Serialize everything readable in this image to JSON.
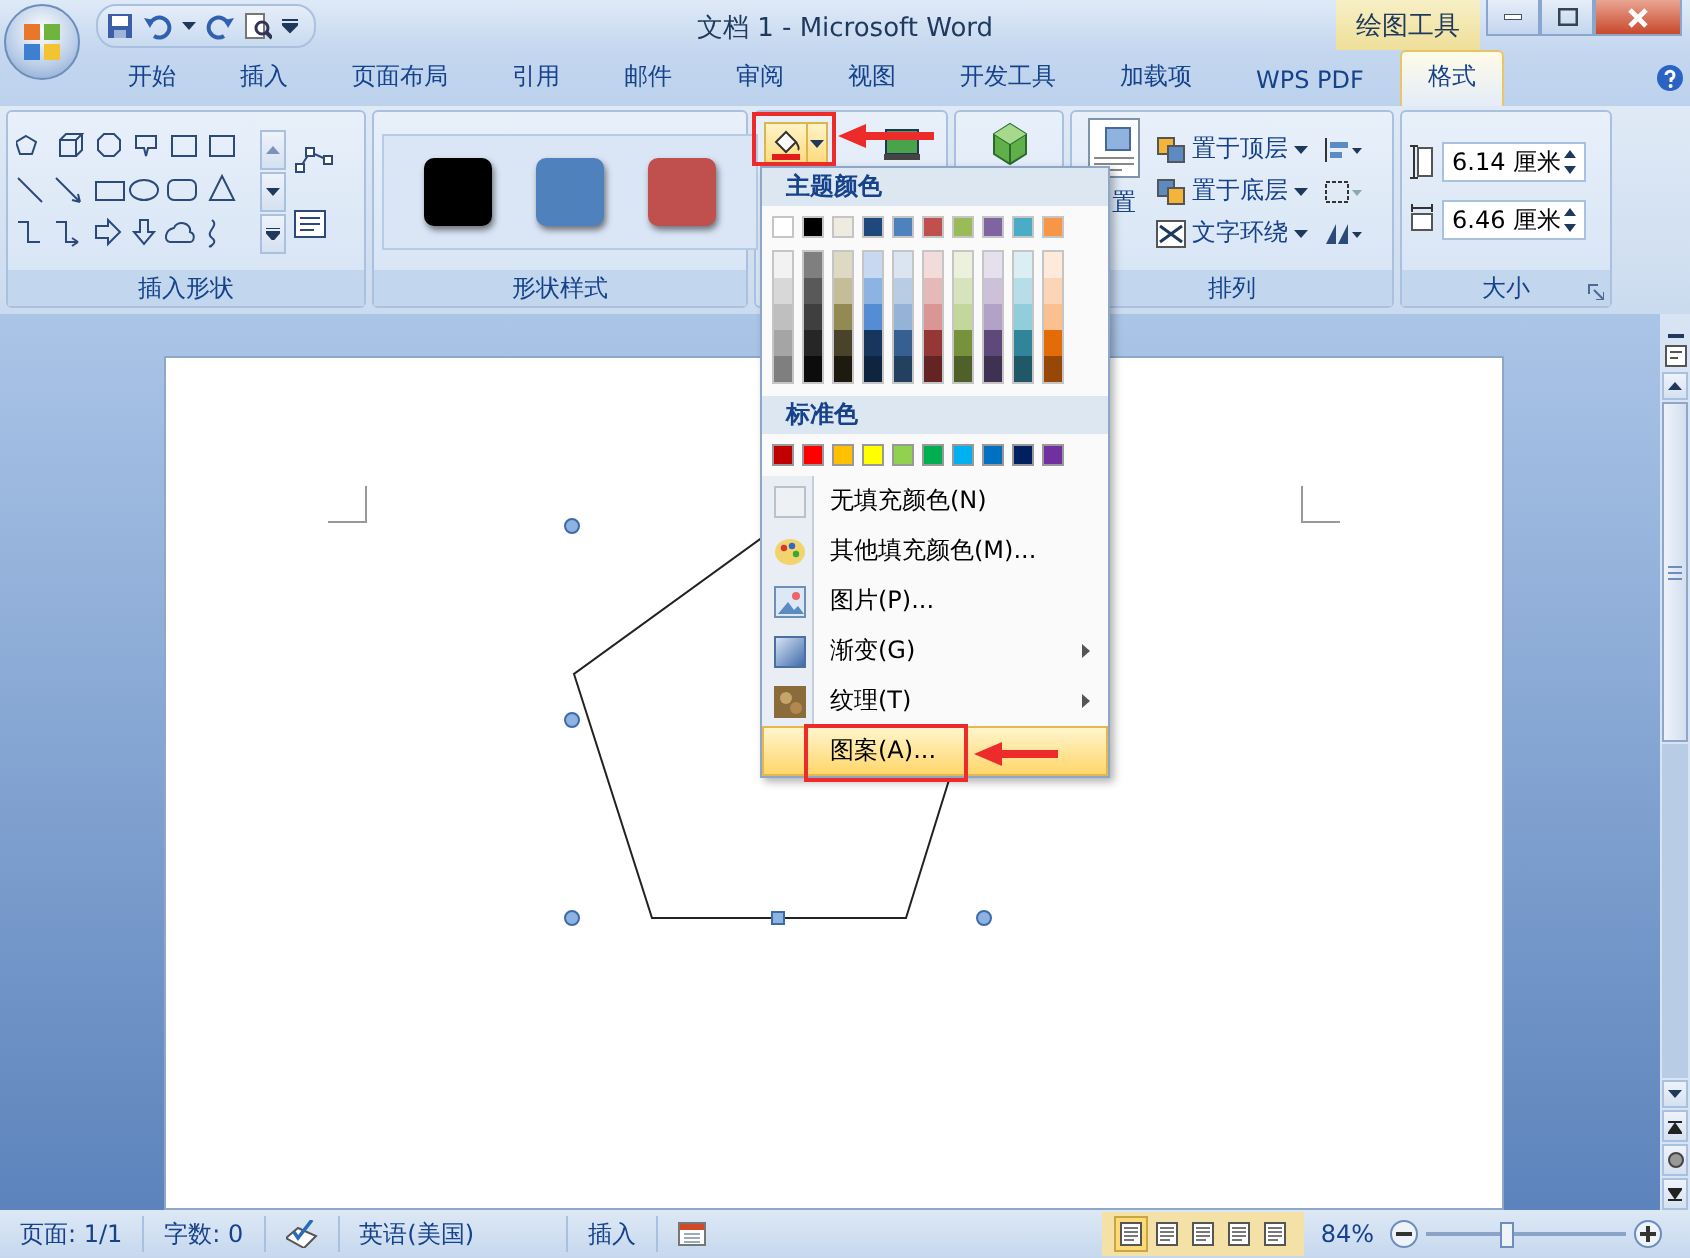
{
  "title_bar": {
    "title": "文档 1 - Microsoft Word",
    "context_label": "绘图工具"
  },
  "tabs": [
    {
      "label": "开始",
      "selected": false
    },
    {
      "label": "插入",
      "selected": false
    },
    {
      "label": "页面布局",
      "selected": false
    },
    {
      "label": "引用",
      "selected": false
    },
    {
      "label": "邮件",
      "selected": false
    },
    {
      "label": "审阅",
      "selected": false
    },
    {
      "label": "视图",
      "selected": false
    },
    {
      "label": "开发工具",
      "selected": false
    },
    {
      "label": "加载项",
      "selected": false
    },
    {
      "label": "WPS PDF",
      "selected": false
    },
    {
      "label": "格式",
      "selected": true
    }
  ],
  "shape_group": {
    "label": "插入形状"
  },
  "style_group": {
    "label": "形状样式",
    "swatches": [
      {
        "color": "#000000"
      },
      {
        "color": "#4f81bd"
      },
      {
        "color": "#c0504d"
      }
    ]
  },
  "arrange_group": {
    "label": "排列",
    "position_label": "置",
    "items": [
      {
        "label": "置于顶层"
      },
      {
        "label": "置于底层"
      },
      {
        "label": "文字环绕"
      }
    ]
  },
  "size_group": {
    "label": "大小",
    "height": "6.14 厘米",
    "width": "6.46 厘米"
  },
  "fill_menu": {
    "theme_heading": "主题颜色",
    "theme_colors": [
      {
        "color": "#ffffff",
        "shades": [
          {
            "color": "#f2f2f2"
          },
          {
            "color": "#d8d8d8"
          },
          {
            "color": "#bfbfbf"
          },
          {
            "color": "#a5a5a5"
          },
          {
            "color": "#7f7f7f"
          }
        ]
      },
      {
        "color": "#000000",
        "shades": [
          {
            "color": "#7f7f7f"
          },
          {
            "color": "#595959"
          },
          {
            "color": "#3f3f3f"
          },
          {
            "color": "#262626"
          },
          {
            "color": "#0c0c0c"
          }
        ]
      },
      {
        "color": "#eeece1",
        "shades": [
          {
            "color": "#ddd9c3"
          },
          {
            "color": "#c4bd97"
          },
          {
            "color": "#938953"
          },
          {
            "color": "#494429"
          },
          {
            "color": "#1d1b10"
          }
        ]
      },
      {
        "color": "#1f497d",
        "shades": [
          {
            "color": "#c6d9f0"
          },
          {
            "color": "#8db3e2"
          },
          {
            "color": "#548dd4"
          },
          {
            "color": "#17365d"
          },
          {
            "color": "#0f243e"
          }
        ]
      },
      {
        "color": "#4f81bd",
        "shades": [
          {
            "color": "#dbe5f1"
          },
          {
            "color": "#b8cce4"
          },
          {
            "color": "#95b3d7"
          },
          {
            "color": "#366092"
          },
          {
            "color": "#244061"
          }
        ]
      },
      {
        "color": "#c0504d",
        "shades": [
          {
            "color": "#f2dcdb"
          },
          {
            "color": "#e5b9b7"
          },
          {
            "color": "#d99694"
          },
          {
            "color": "#953734"
          },
          {
            "color": "#632423"
          }
        ]
      },
      {
        "color": "#9bbb59",
        "shades": [
          {
            "color": "#ebf1dd"
          },
          {
            "color": "#d7e3bc"
          },
          {
            "color": "#c3d69b"
          },
          {
            "color": "#76923c"
          },
          {
            "color": "#4f6128"
          }
        ]
      },
      {
        "color": "#8064a2",
        "shades": [
          {
            "color": "#e5e0ec"
          },
          {
            "color": "#ccc1d9"
          },
          {
            "color": "#b2a2c7"
          },
          {
            "color": "#5f497a"
          },
          {
            "color": "#3f3151"
          }
        ]
      },
      {
        "color": "#4bacc6",
        "shades": [
          {
            "color": "#dbeef3"
          },
          {
            "color": "#b7dde8"
          },
          {
            "color": "#92cddc"
          },
          {
            "color": "#31859b"
          },
          {
            "color": "#205867"
          }
        ]
      },
      {
        "color": "#f79646",
        "shades": [
          {
            "color": "#fdeada"
          },
          {
            "color": "#fbd5b5"
          },
          {
            "color": "#fac08f"
          },
          {
            "color": "#e36c09"
          },
          {
            "color": "#974806"
          }
        ]
      }
    ],
    "standard_heading": "标准色",
    "standard_colors": [
      {
        "color": "#c00000"
      },
      {
        "color": "#ff0000"
      },
      {
        "color": "#ffc000"
      },
      {
        "color": "#ffff00"
      },
      {
        "color": "#92d050"
      },
      {
        "color": "#00b050"
      },
      {
        "color": "#00b0f0"
      },
      {
        "color": "#0070c0"
      },
      {
        "color": "#002060"
      },
      {
        "color": "#7030a0"
      }
    ],
    "items": [
      {
        "kind": "no-fill",
        "label": "无填充颜色(N)",
        "submenu": false,
        "selected": false
      },
      {
        "kind": "more-colors",
        "label": "其他填充颜色(M)...",
        "submenu": false,
        "selected": false
      },
      {
        "kind": "picture",
        "label": "图片(P)...",
        "submenu": false,
        "selected": false
      },
      {
        "kind": "gradient",
        "label": "渐变(G)",
        "submenu": true,
        "selected": false
      },
      {
        "kind": "texture",
        "label": "纹理(T)",
        "submenu": true,
        "selected": false
      },
      {
        "kind": "pattern",
        "label": "图案(A)...",
        "submenu": false,
        "selected": true
      }
    ]
  },
  "status_bar": {
    "page": "页面: 1/1",
    "words": "字数: 0",
    "language": "英语(美国)",
    "mode": "插入",
    "views": [
      {
        "selected": true
      },
      {
        "selected": false
      },
      {
        "selected": false
      },
      {
        "selected": false
      },
      {
        "selected": false
      }
    ],
    "zoom": "84%",
    "zoom_slider": {
      "level": 0.4
    }
  }
}
